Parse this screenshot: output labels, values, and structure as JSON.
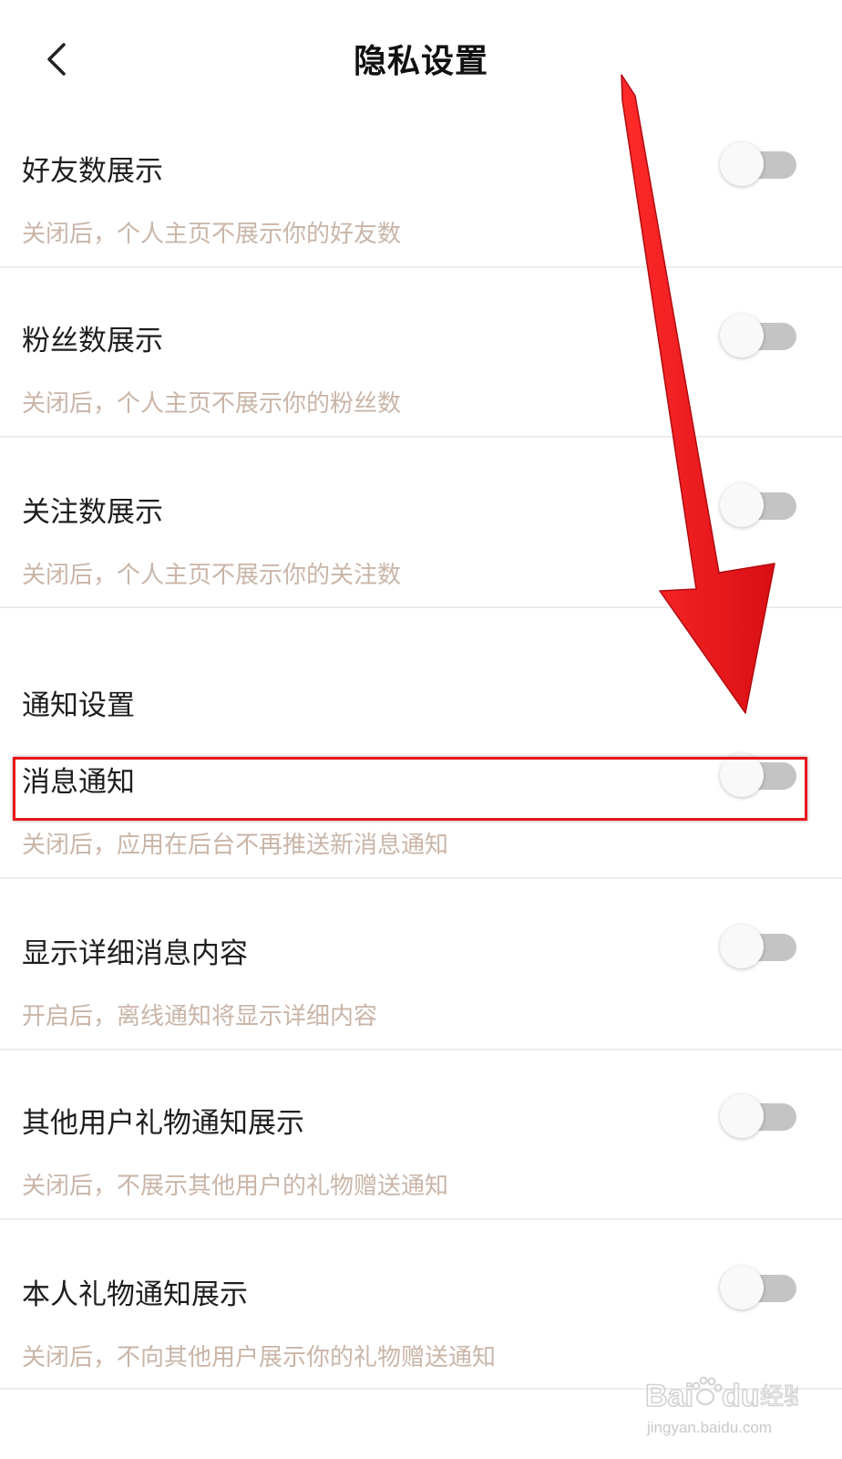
{
  "header": {
    "title": "隐私设置",
    "back_icon": "chevron-left-icon"
  },
  "settings": [
    {
      "title": "好友数展示",
      "description": "关闭后，个人主页不展示你的好友数",
      "enabled": false
    },
    {
      "title": "粉丝数展示",
      "description": "关闭后，个人主页不展示你的粉丝数",
      "enabled": false
    },
    {
      "title": "关注数展示",
      "description": "关闭后，个人主页不展示你的关注数",
      "enabled": false
    }
  ],
  "notification_section": {
    "header": "通知设置",
    "items": [
      {
        "title": "消息通知",
        "description": "关闭后，应用在后台不再推送新消息通知",
        "enabled": false,
        "highlighted": true
      },
      {
        "title": "显示详细消息内容",
        "description": "开启后，离线通知将显示详细内容",
        "enabled": false
      },
      {
        "title": "其他用户礼物通知展示",
        "description": "关闭后，不展示其他用户的礼物赠送通知",
        "enabled": false
      },
      {
        "title": "本人礼物通知展示",
        "description": "关闭后，不向其他用户展示你的礼物赠送通知",
        "enabled": false
      }
    ]
  },
  "annotation": {
    "arrow_color": "#e8151a",
    "highlight_color": "#e8151a"
  },
  "watermark": {
    "logo_text": "Baidu经验",
    "url": "jingyan.baidu.com"
  },
  "colors": {
    "title_text": "#1e1e1e",
    "description_text": "#c9b5a8",
    "toggle_track_off": "#c4c4c4",
    "divider": "#ededed"
  }
}
